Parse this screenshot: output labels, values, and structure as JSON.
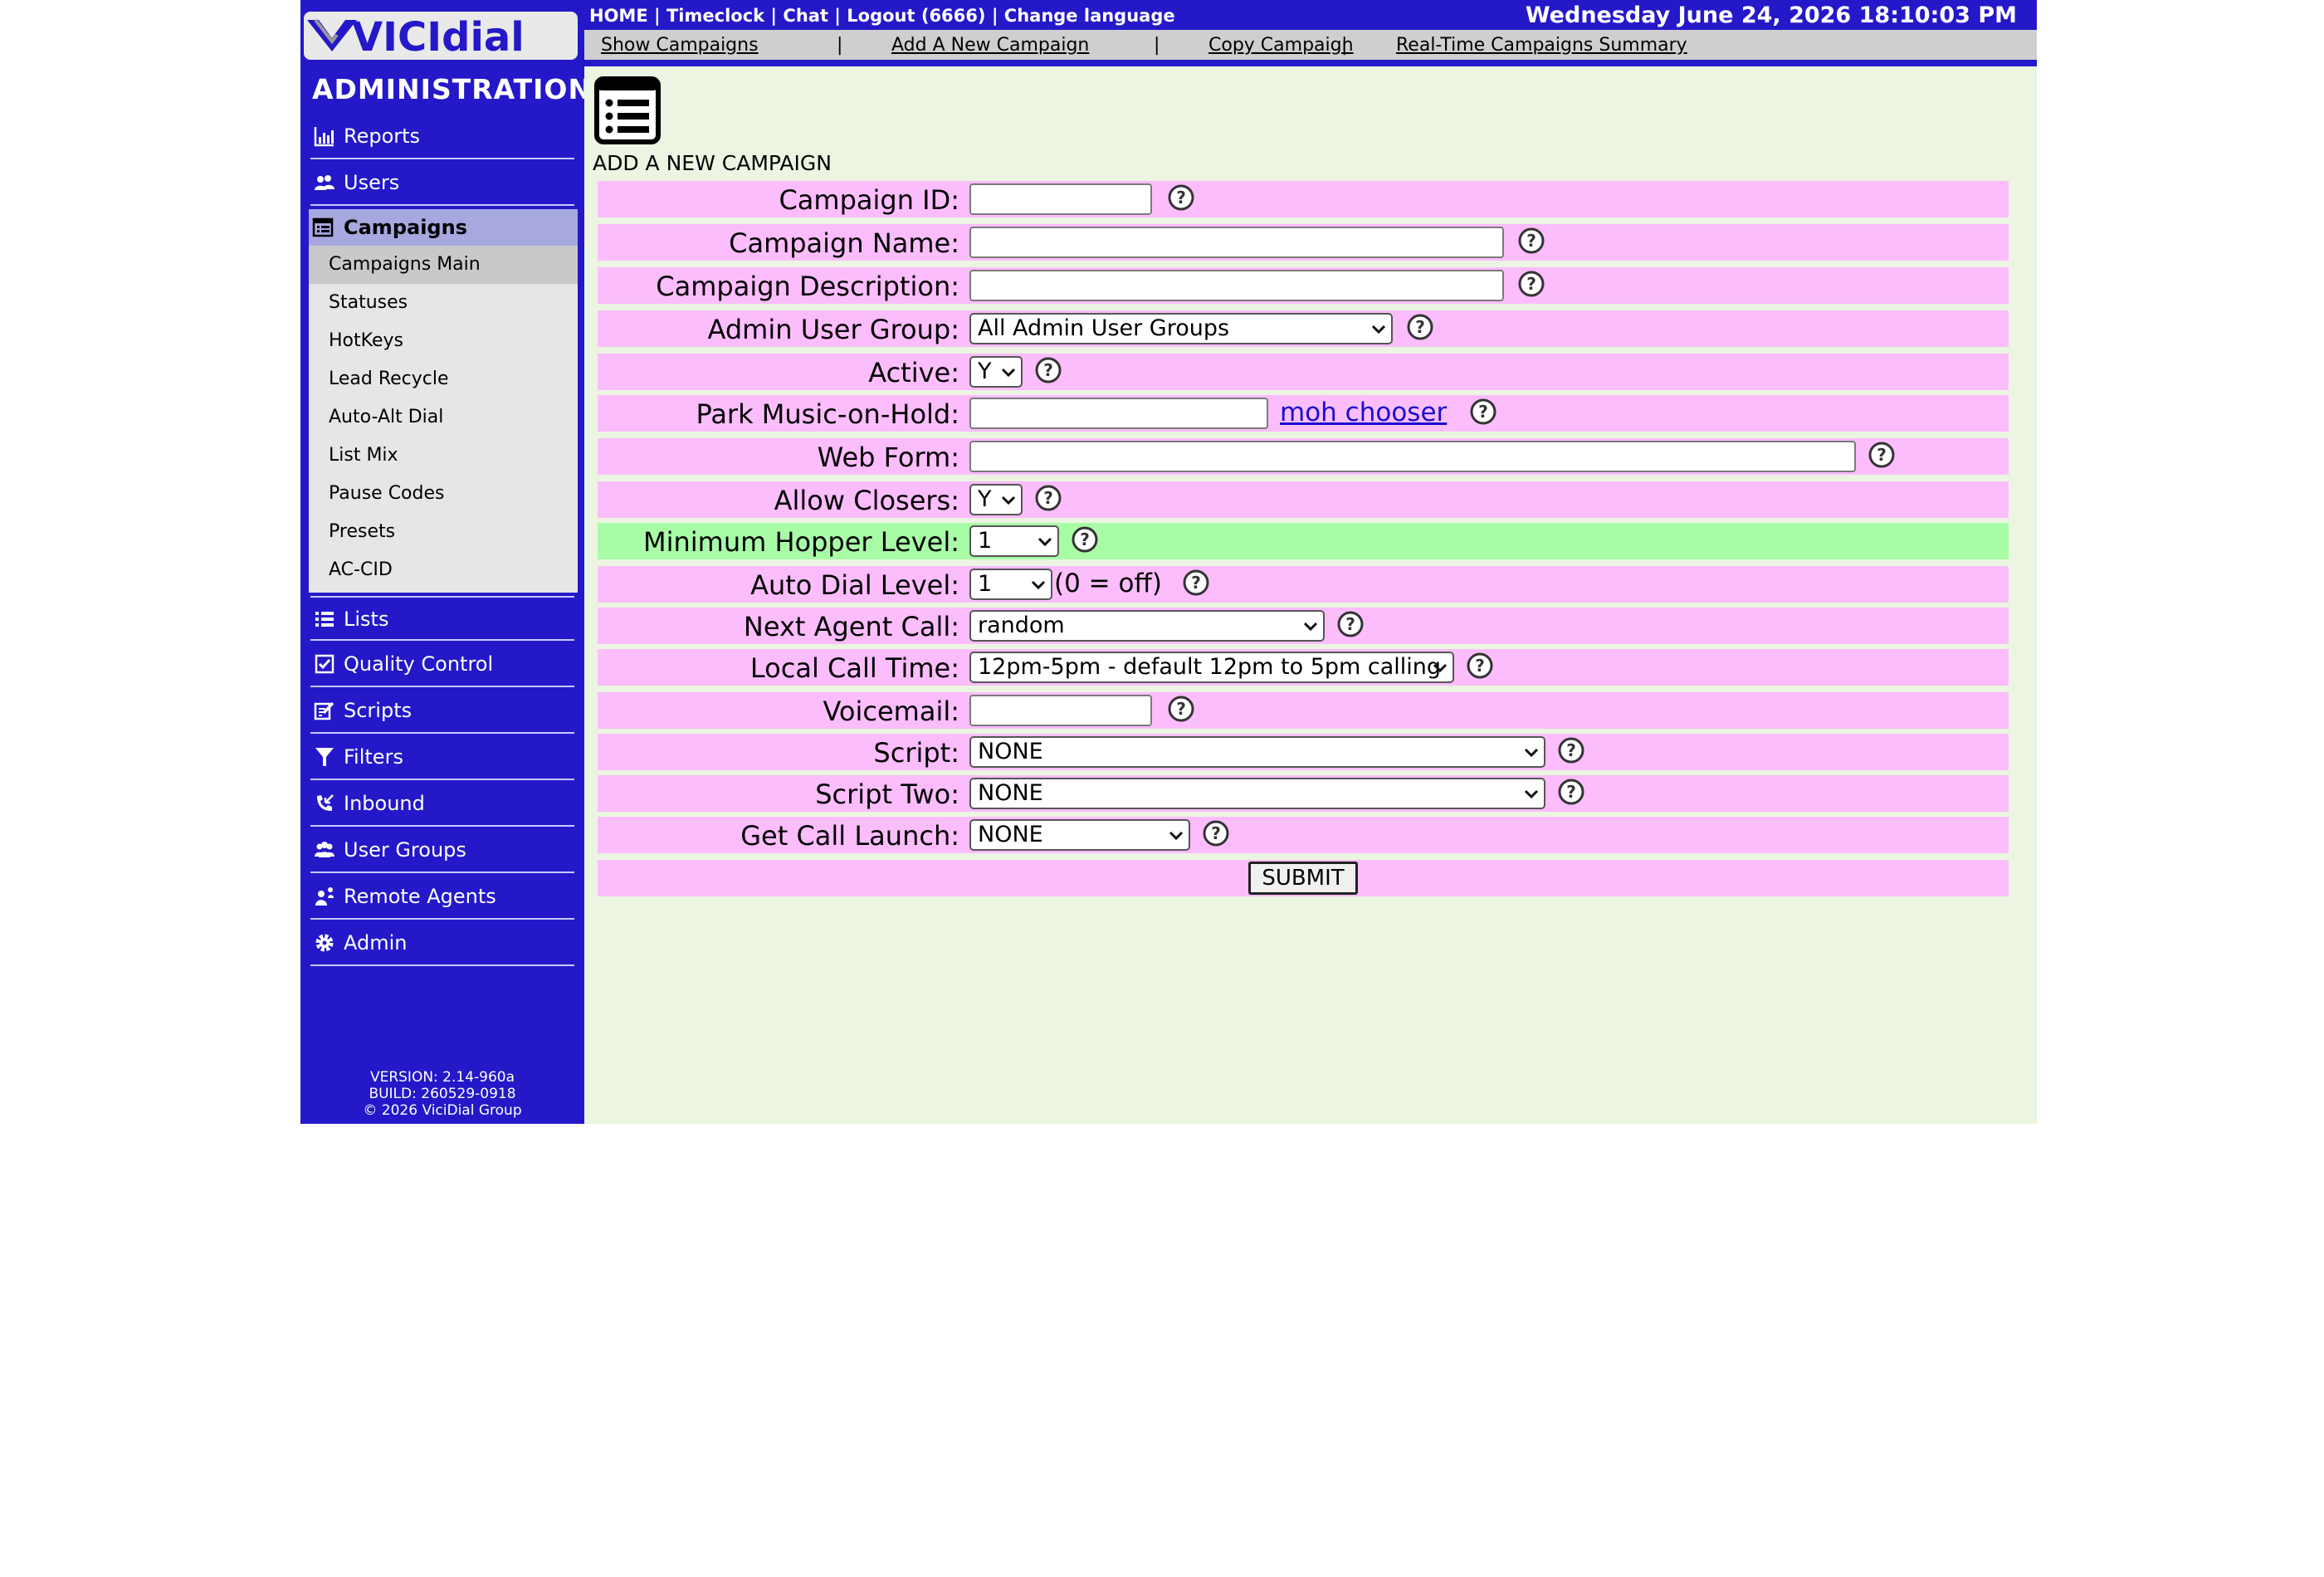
{
  "header": {
    "links": [
      "HOME",
      "Timeclock",
      "Chat",
      "Logout (6666)",
      "Change language"
    ],
    "separator": "|",
    "datetime": "Wednesday June 24, 2026 18:10:03 PM"
  },
  "subnav": {
    "items": [
      "Show Campaigns",
      "Add A New Campaign",
      "Copy Campaign",
      "Real-Time Campaigns Summary"
    ],
    "separator": "|"
  },
  "sidebar": {
    "logo_text": "VICIdial",
    "title": "ADMINISTRATION",
    "items_top": [
      {
        "label": "Reports",
        "icon": "reports-icon"
      },
      {
        "label": "Users",
        "icon": "users-icon"
      }
    ],
    "campaigns": {
      "label": "Campaigns",
      "icon": "campaigns-icon",
      "subitems": [
        "Campaigns Main",
        "Statuses",
        "HotKeys",
        "Lead Recycle",
        "Auto-Alt Dial",
        "List Mix",
        "Pause Codes",
        "Presets",
        "AC-CID"
      ],
      "active_subitem": "Campaigns Main"
    },
    "items_bottom": [
      {
        "label": "Lists",
        "icon": "lists-icon"
      },
      {
        "label": "Quality Control",
        "icon": "quality-control-icon"
      },
      {
        "label": "Scripts",
        "icon": "scripts-icon"
      },
      {
        "label": "Filters",
        "icon": "filter-icon"
      },
      {
        "label": "Inbound",
        "icon": "inbound-icon"
      },
      {
        "label": "User Groups",
        "icon": "user-groups-icon"
      },
      {
        "label": "Remote Agents",
        "icon": "remote-agents-icon"
      },
      {
        "label": "Admin",
        "icon": "gear-icon"
      }
    ],
    "version": "VERSION: 2.14-960a",
    "build": "BUILD: 260529-0918",
    "copyright": "© 2026 ViciDial Group"
  },
  "main": {
    "section_title": "ADD A NEW CAMPAIGN",
    "form": {
      "campaign_id": {
        "label": "Campaign ID:",
        "value": ""
      },
      "campaign_name": {
        "label": "Campaign Name:",
        "value": ""
      },
      "campaign_description": {
        "label": "Campaign Description:",
        "value": ""
      },
      "admin_user_group": {
        "label": "Admin User Group:",
        "value": "All Admin User Groups"
      },
      "active": {
        "label": "Active:",
        "value": "Y"
      },
      "park_moh": {
        "label": "Park Music-on-Hold:",
        "value": "",
        "link": "moh chooser"
      },
      "web_form": {
        "label": "Web Form:",
        "value": ""
      },
      "allow_closers": {
        "label": "Allow Closers:",
        "value": "Y"
      },
      "min_hopper_level": {
        "label": "Minimum Hopper Level:",
        "value": "1"
      },
      "auto_dial_level": {
        "label": "Auto Dial Level:",
        "value": "1",
        "note": "(0 = off)"
      },
      "next_agent_call": {
        "label": "Next Agent Call:",
        "value": "random"
      },
      "local_call_time": {
        "label": "Local Call Time:",
        "value": "12pm-5pm - default 12pm to 5pm calling"
      },
      "voicemail": {
        "label": "Voicemail:",
        "value": ""
      },
      "script": {
        "label": "Script:",
        "value": "NONE"
      },
      "script_two": {
        "label": "Script Two:",
        "value": "NONE"
      },
      "get_call_launch": {
        "label": "Get Call Launch:",
        "value": "NONE"
      },
      "submit_label": "SUBMIT"
    }
  },
  "colors": {
    "nav_blue": "#2418c9",
    "row_pink": "#fcbdfc",
    "row_green": "#a8fca6",
    "content_bg": "#ebf5e2",
    "link_blue": "#1a0dcc"
  }
}
